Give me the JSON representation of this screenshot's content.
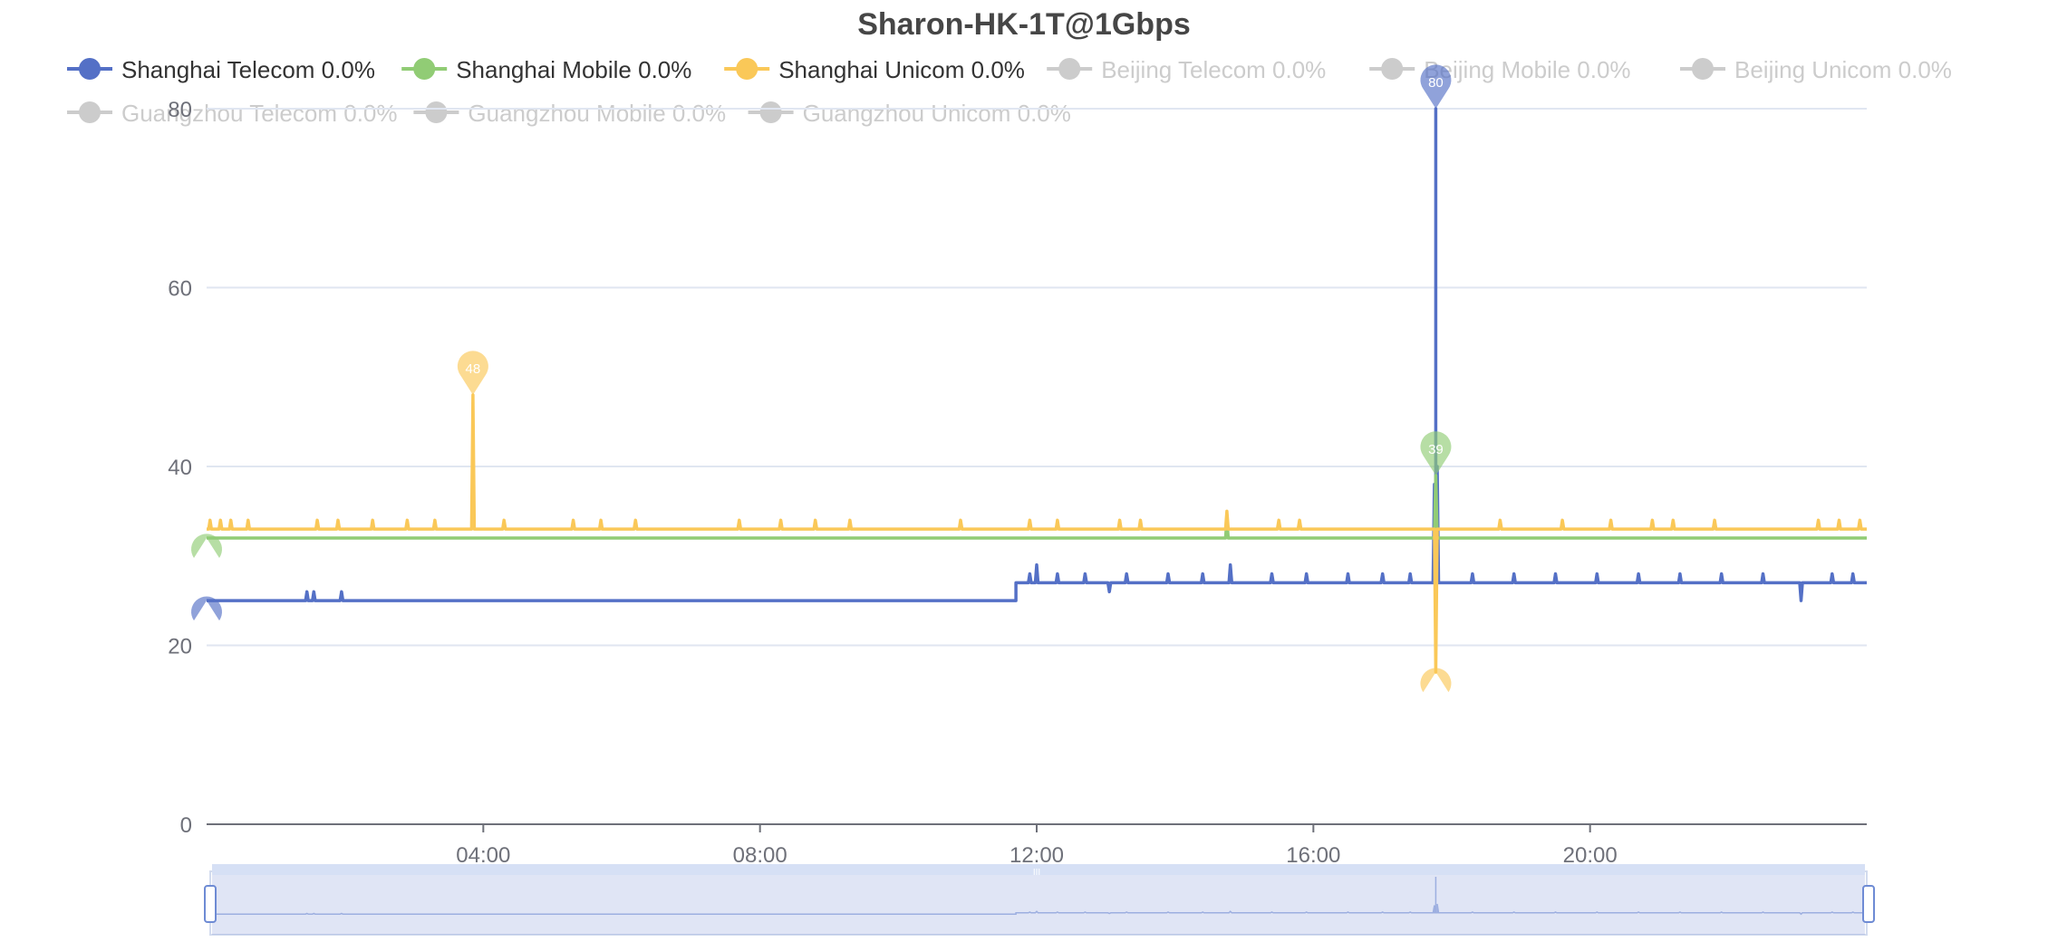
{
  "chart_data": {
    "type": "line",
    "title": "Sharon-HK-1T@1Gbps",
    "xlabel": "",
    "ylabel": "",
    "x_range_hours": [
      0,
      24
    ],
    "ylim": [
      0,
      80
    ],
    "y_ticks": [
      0,
      20,
      40,
      60,
      80
    ],
    "x_ticks": [
      {
        "hour": 4,
        "label": "04:00"
      },
      {
        "hour": 8,
        "label": "08:00"
      },
      {
        "hour": 12,
        "label": "12:00"
      },
      {
        "hour": 16,
        "label": "16:00"
      },
      {
        "hour": 20,
        "label": "20:00"
      }
    ],
    "grid": true,
    "legend_position": "top",
    "series": [
      {
        "name": "Shanghai Telecom 0.0%",
        "color": "#5470c6",
        "active": true,
        "base_segments": [
          {
            "from_hour": 0,
            "to_hour": 11.7,
            "value": 25
          },
          {
            "from_hour": 11.7,
            "to_hour": 24,
            "value": 27
          }
        ],
        "points": [
          {
            "hour": 1.45,
            "value": 26
          },
          {
            "hour": 1.55,
            "value": 26
          },
          {
            "hour": 1.95,
            "value": 26
          },
          {
            "hour": 11.9,
            "value": 28
          },
          {
            "hour": 12.0,
            "value": 29
          },
          {
            "hour": 12.3,
            "value": 28
          },
          {
            "hour": 12.7,
            "value": 28
          },
          {
            "hour": 13.05,
            "value": 26
          },
          {
            "hour": 13.3,
            "value": 28
          },
          {
            "hour": 13.9,
            "value": 28
          },
          {
            "hour": 14.4,
            "value": 28
          },
          {
            "hour": 14.8,
            "value": 29
          },
          {
            "hour": 15.4,
            "value": 28
          },
          {
            "hour": 15.9,
            "value": 28
          },
          {
            "hour": 16.5,
            "value": 28
          },
          {
            "hour": 17.0,
            "value": 28
          },
          {
            "hour": 17.4,
            "value": 28
          },
          {
            "hour": 17.75,
            "value": 38
          },
          {
            "hour": 17.77,
            "value": 80
          },
          {
            "hour": 17.79,
            "value": 40
          },
          {
            "hour": 18.3,
            "value": 28
          },
          {
            "hour": 18.9,
            "value": 28
          },
          {
            "hour": 19.5,
            "value": 28
          },
          {
            "hour": 20.1,
            "value": 28
          },
          {
            "hour": 20.7,
            "value": 28
          },
          {
            "hour": 21.3,
            "value": 28
          },
          {
            "hour": 21.9,
            "value": 28
          },
          {
            "hour": 22.5,
            "value": 28
          },
          {
            "hour": 23.05,
            "value": 25
          },
          {
            "hour": 23.5,
            "value": 28
          },
          {
            "hour": 23.8,
            "value": 28
          }
        ],
        "markers": [
          {
            "type": "min",
            "hour": 0,
            "value": 25,
            "label": "25"
          },
          {
            "type": "max",
            "hour": 17.77,
            "value": 80,
            "label": "80"
          }
        ]
      },
      {
        "name": "Shanghai Mobile 0.0%",
        "color": "#91cc75",
        "active": true,
        "base_segments": [
          {
            "from_hour": 0,
            "to_hour": 24,
            "value": 32
          }
        ],
        "points": [
          {
            "hour": 14.75,
            "value": 34
          },
          {
            "hour": 17.77,
            "value": 39
          }
        ],
        "markers": [
          {
            "type": "min",
            "hour": 0,
            "value": 32,
            "label": "32"
          },
          {
            "type": "max",
            "hour": 17.77,
            "value": 39,
            "label": "39"
          }
        ]
      },
      {
        "name": "Shanghai Unicom 0.0%",
        "color": "#fac858",
        "active": true,
        "base_segments": [
          {
            "from_hour": 0,
            "to_hour": 24,
            "value": 33
          }
        ],
        "points": [
          {
            "hour": 0.05,
            "value": 34
          },
          {
            "hour": 0.2,
            "value": 34
          },
          {
            "hour": 0.35,
            "value": 34
          },
          {
            "hour": 0.6,
            "value": 34
          },
          {
            "hour": 1.6,
            "value": 34
          },
          {
            "hour": 1.9,
            "value": 34
          },
          {
            "hour": 2.4,
            "value": 34
          },
          {
            "hour": 2.9,
            "value": 34
          },
          {
            "hour": 3.3,
            "value": 34
          },
          {
            "hour": 3.85,
            "value": 48
          },
          {
            "hour": 4.3,
            "value": 34
          },
          {
            "hour": 5.3,
            "value": 34
          },
          {
            "hour": 5.7,
            "value": 34
          },
          {
            "hour": 6.2,
            "value": 34
          },
          {
            "hour": 7.7,
            "value": 34
          },
          {
            "hour": 8.3,
            "value": 34
          },
          {
            "hour": 8.8,
            "value": 34
          },
          {
            "hour": 9.3,
            "value": 34
          },
          {
            "hour": 10.9,
            "value": 34
          },
          {
            "hour": 11.9,
            "value": 34
          },
          {
            "hour": 12.3,
            "value": 34
          },
          {
            "hour": 13.2,
            "value": 34
          },
          {
            "hour": 13.5,
            "value": 34
          },
          {
            "hour": 14.75,
            "value": 35
          },
          {
            "hour": 15.5,
            "value": 34
          },
          {
            "hour": 15.8,
            "value": 34
          },
          {
            "hour": 17.77,
            "value": 17
          },
          {
            "hour": 18.7,
            "value": 34
          },
          {
            "hour": 19.6,
            "value": 34
          },
          {
            "hour": 20.3,
            "value": 34
          },
          {
            "hour": 20.9,
            "value": 34
          },
          {
            "hour": 21.2,
            "value": 34
          },
          {
            "hour": 21.8,
            "value": 34
          },
          {
            "hour": 23.3,
            "value": 34
          },
          {
            "hour": 23.6,
            "value": 34
          },
          {
            "hour": 23.9,
            "value": 34
          }
        ],
        "markers": [
          {
            "type": "max",
            "hour": 3.85,
            "value": 48,
            "label": "48"
          },
          {
            "type": "min",
            "hour": 17.77,
            "value": 17,
            "label": "17"
          }
        ]
      },
      {
        "name": "Beijing Telecom 0.0%",
        "color": "#cccccc",
        "active": false
      },
      {
        "name": "Beijing Mobile 0.0%",
        "color": "#cccccc",
        "active": false
      },
      {
        "name": "Beijing Unicom 0.0%",
        "color": "#cccccc",
        "active": false
      },
      {
        "name": "Guangzhou Telecom 0.0%",
        "color": "#cccccc",
        "active": false
      },
      {
        "name": "Guangzhou Mobile 0.0%",
        "color": "#cccccc",
        "active": false
      },
      {
        "name": "Guangzhou Unicom 0.0%",
        "color": "#cccccc",
        "active": false
      }
    ],
    "data_zoom": {
      "start_percent": 0,
      "end_percent": 100,
      "handle_label": "III"
    }
  }
}
